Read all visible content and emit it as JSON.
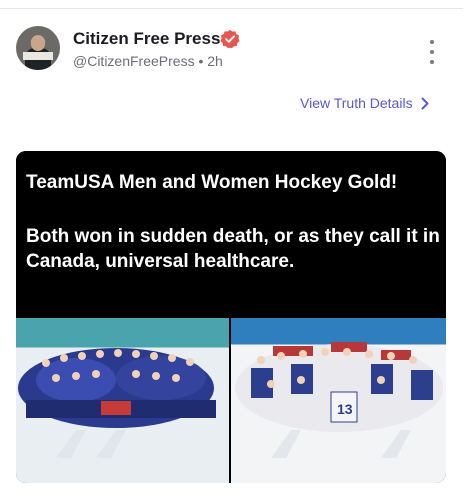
{
  "post": {
    "author_name": "Citizen Free Press",
    "handle": "@CitizenFreePress",
    "separator": "•",
    "time": "2h",
    "details_link": "View Truth Details"
  },
  "media": {
    "caption_line1": "TeamUSA Men and Women Hockey Gold!",
    "caption_line2": "Both won in sudden death, or as they call it in Canada, universal healthcare.",
    "jersey_number": "13"
  },
  "colors": {
    "link": "#5b57d6",
    "verified_badge": "#e8554f"
  },
  "icons": {
    "verified": "verified-badge-icon",
    "more": "more-vertical-icon",
    "chevron": "chevron-right-icon"
  }
}
